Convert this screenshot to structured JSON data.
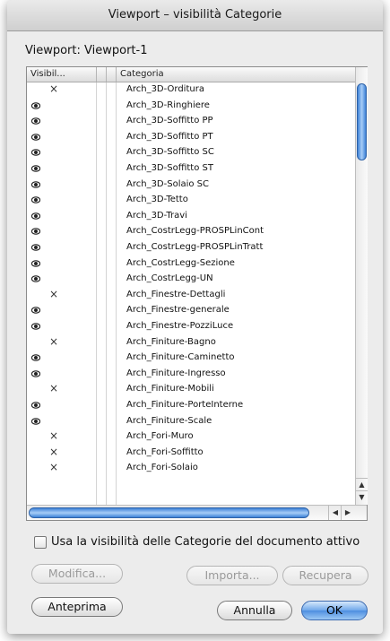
{
  "window": {
    "title": "Viewport – visibilità Categorie"
  },
  "viewport_label": "Viewport: Viewport-1",
  "table": {
    "columns": [
      "Visibil...",
      "Categoria"
    ],
    "rows": [
      {
        "visibility": "hidden",
        "name": "Arch_3D-Orditura"
      },
      {
        "visibility": "visible",
        "name": "Arch_3D-Ringhiere"
      },
      {
        "visibility": "visible",
        "name": "Arch_3D-Soffitto PP"
      },
      {
        "visibility": "visible",
        "name": "Arch_3D-Soffitto PT"
      },
      {
        "visibility": "visible",
        "name": "Arch_3D-Soffitto SC"
      },
      {
        "visibility": "visible",
        "name": "Arch_3D-Soffitto ST"
      },
      {
        "visibility": "visible",
        "name": "Arch_3D-Solaio SC"
      },
      {
        "visibility": "visible",
        "name": "Arch_3D-Tetto"
      },
      {
        "visibility": "visible",
        "name": "Arch_3D-Travi"
      },
      {
        "visibility": "visible",
        "name": "Arch_CostrLegg-PROSPLinCont"
      },
      {
        "visibility": "visible",
        "name": "Arch_CostrLegg-PROSPLinTratt"
      },
      {
        "visibility": "visible",
        "name": "Arch_CostrLegg-Sezione"
      },
      {
        "visibility": "visible",
        "name": "Arch_CostrLegg-UN"
      },
      {
        "visibility": "hidden",
        "name": "Arch_Finestre-Dettagli"
      },
      {
        "visibility": "visible",
        "name": "Arch_Finestre-generale"
      },
      {
        "visibility": "visible",
        "name": "Arch_Finestre-PozziLuce"
      },
      {
        "visibility": "hidden",
        "name": "Arch_Finiture-Bagno"
      },
      {
        "visibility": "visible",
        "name": "Arch_Finiture-Caminetto"
      },
      {
        "visibility": "visible",
        "name": "Arch_Finiture-Ingresso"
      },
      {
        "visibility": "hidden",
        "name": "Arch_Finiture-Mobili"
      },
      {
        "visibility": "visible",
        "name": "Arch_Finiture-PorteInterne"
      },
      {
        "visibility": "visible",
        "name": "Arch_Finiture-Scale"
      },
      {
        "visibility": "hidden",
        "name": "Arch_Fori-Muro"
      },
      {
        "visibility": "hidden",
        "name": "Arch_Fori-Soffitto"
      },
      {
        "visibility": "hidden",
        "name": "Arch_Fori-Solaio"
      }
    ],
    "hidden_mark": "×",
    "scroll": {
      "up": "▲",
      "down": "▼",
      "left": "◀",
      "right": "▶"
    }
  },
  "checkbox": {
    "label": "Usa la visibilità delle Categorie del documento attivo",
    "checked": false
  },
  "buttons": {
    "modifica": "Modifica...",
    "importa": "Importa...",
    "recupera": "Recupera",
    "anteprima": "Anteprima",
    "annulla": "Annulla",
    "ok": "OK"
  },
  "colors": {
    "accent": "#4d8ee0",
    "scroll_thumb": "#3e82d7"
  }
}
